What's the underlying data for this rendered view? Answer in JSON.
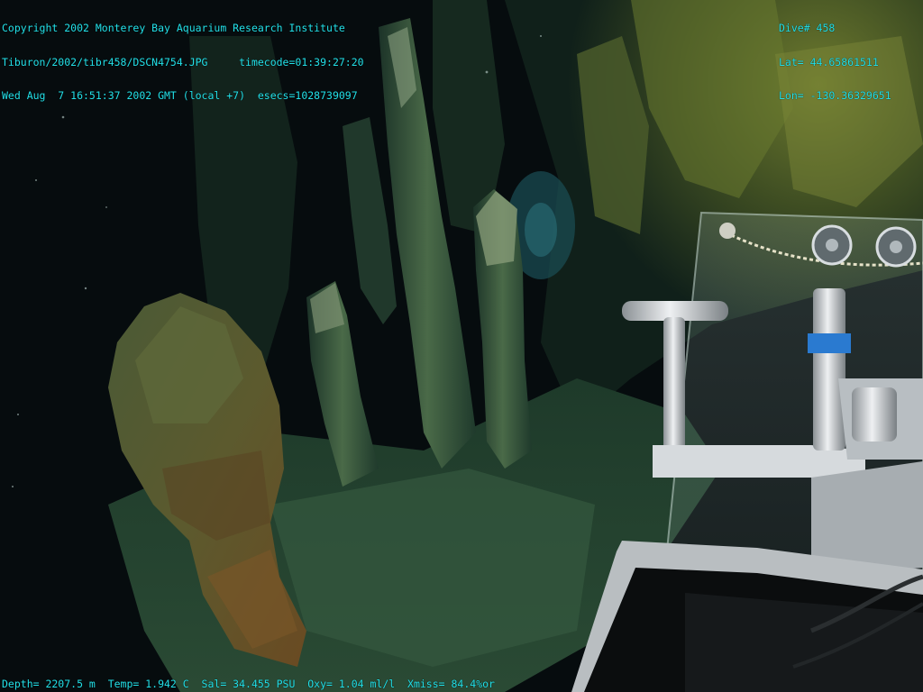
{
  "overlay": {
    "text_color": "#22e0e8",
    "top_left": [
      "Copyright 2002 Monterey Bay Aquarium Research Institute",
      "Tiburon/2002/tibr458/DSCN4754.JPG     timecode=01:39:27:20",
      "Wed Aug  7 16:51:37 2002 GMT (local +7)  esecs=1028739097"
    ],
    "top_right": [
      "Dive# 458",
      "Lat= 44.65861511",
      "Lon= -130.36329651"
    ],
    "bottom": "Depth= 2207.5 m  Temp= 1.942 C  Sal= 34.455 PSU  Oxy= 1.04 ml/l  Xmiss= 84.4%or"
  },
  "scene": {
    "subject": "hydrothermal-vent-chimneys",
    "equipment": "rov-sampler-with-acrylic-shield",
    "colors": {
      "water": "#060c0e",
      "rock_dark": "#1f3a2c",
      "rock_mid": "#3c5a3a",
      "rock_light": "#6f8a5e",
      "microbial_mat": "#7a8a38",
      "rust": "#7a5a28",
      "metal": "#c9cdd0",
      "blue_band": "#2a7ad0"
    }
  }
}
